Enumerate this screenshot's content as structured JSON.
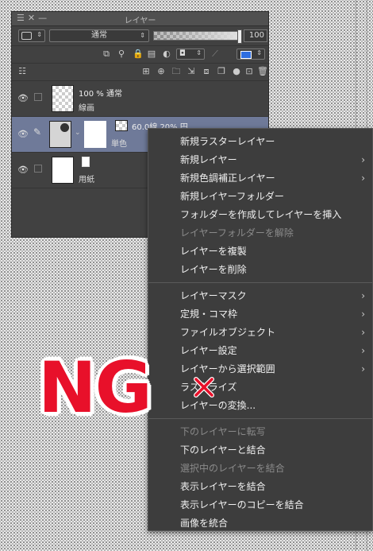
{
  "panel": {
    "title": "レイヤー",
    "blend_mode": "通常",
    "opacity_value": "100",
    "opacity_fraction": 1.0,
    "layers": [
      {
        "name": "100 % 通常",
        "sub": "線画"
      },
      {
        "name": "60.0線 20% 円",
        "sub": "単色"
      },
      {
        "name": "",
        "sub": "用紙"
      }
    ]
  },
  "menu": {
    "items": [
      {
        "label": "新規ラスターレイヤー",
        "enabled": true,
        "submenu": false
      },
      {
        "label": "新規レイヤー",
        "enabled": true,
        "submenu": true
      },
      {
        "label": "新規色調補正レイヤー",
        "enabled": true,
        "submenu": true
      },
      {
        "label": "新規レイヤーフォルダー",
        "enabled": true,
        "submenu": false
      },
      {
        "label": "フォルダーを作成してレイヤーを挿入",
        "enabled": true,
        "submenu": false
      },
      {
        "label": "レイヤーフォルダーを解除",
        "enabled": false,
        "submenu": false
      },
      {
        "label": "レイヤーを複製",
        "enabled": true,
        "submenu": false
      },
      {
        "label": "レイヤーを削除",
        "enabled": true,
        "submenu": false
      },
      {
        "label": "レイヤーマスク",
        "enabled": true,
        "submenu": true
      },
      {
        "label": "定規・コマ枠",
        "enabled": true,
        "submenu": true
      },
      {
        "label": "ファイルオブジェクト",
        "enabled": true,
        "submenu": true
      },
      {
        "label": "レイヤー設定",
        "enabled": true,
        "submenu": true
      },
      {
        "label": "レイヤーから選択範囲",
        "enabled": true,
        "submenu": true
      },
      {
        "label": "ラスタライズ",
        "enabled": true,
        "submenu": false
      },
      {
        "label": "レイヤーの変換...",
        "enabled": true,
        "submenu": false
      },
      {
        "label": "下のレイヤーに転写",
        "enabled": false,
        "submenu": false
      },
      {
        "label": "下のレイヤーと結合",
        "enabled": true,
        "submenu": false
      },
      {
        "label": "選択中のレイヤーを結合",
        "enabled": false,
        "submenu": false
      },
      {
        "label": "表示レイヤーを結合",
        "enabled": true,
        "submenu": false
      },
      {
        "label": "表示レイヤーのコピーを結合",
        "enabled": true,
        "submenu": false
      },
      {
        "label": "画像を統合",
        "enabled": true,
        "submenu": false
      }
    ]
  },
  "stamp": {
    "text": "NG",
    "color": "#e8102a"
  },
  "colors": {
    "panel_bg": "#414141",
    "menu_bg": "#3d3d3d",
    "selected_layer": "#6f7a99"
  }
}
